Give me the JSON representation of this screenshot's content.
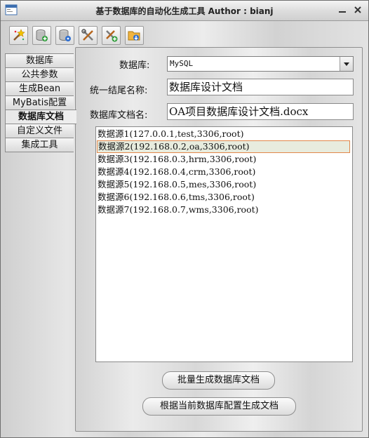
{
  "window": {
    "title": "基于数据库的自动化生成工具  Author : bianj",
    "minimize_symbol": "—",
    "close_symbol": "✕"
  },
  "toolbar": {
    "icons": [
      "magic-wand-icon",
      "add-database-icon",
      "database-settings-icon",
      "tools-icon",
      "tools-add-icon",
      "folder-download-icon"
    ]
  },
  "tabs": [
    {
      "label": "数据库"
    },
    {
      "label": "公共参数"
    },
    {
      "label": "生成Bean"
    },
    {
      "label": "MyBatis配置"
    },
    {
      "label": "数据库文档",
      "active": true
    },
    {
      "label": "自定义文件"
    },
    {
      "label": "集成工具"
    }
  ],
  "form": {
    "db_label": "数据库:",
    "db_value": "MySQL",
    "suffix_label": "统一结尾名称:",
    "suffix_value": "数据库设计文档",
    "docname_label": "数据库文档名:",
    "docname_value": "OA项目数据库设计文档.docx"
  },
  "datasources": [
    "数据源1(127.0.0.1,test,3306,root)",
    "数据源2(192.168.0.2,oa,3306,root)",
    "数据源3(192.168.0.3,hrm,3306,root)",
    "数据源4(192.168.0.4,crm,3306,root)",
    "数据源5(192.168.0.5,mes,3306,root)",
    "数据源6(192.168.0.6,tms,3306,root)",
    "数据源7(192.168.0.7,wms,3306,root)"
  ],
  "selected_index": 1,
  "buttons": {
    "batch_generate": "批量生成数据库文档",
    "generate_current": "根据当前数据库配置生成文档"
  },
  "colors": {
    "selection_border": "#e2874a",
    "selection_fill": "#e8ecde"
  }
}
